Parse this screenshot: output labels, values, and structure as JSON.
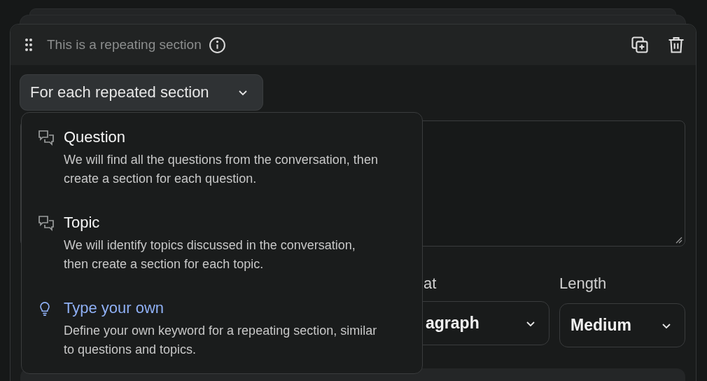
{
  "section": {
    "title": "This is a repeating section"
  },
  "repeat_select": {
    "value": "For each repeated section",
    "expanded": true
  },
  "menu": [
    {
      "kind": "preset",
      "title": "Question",
      "description": "We will find all the questions from the conversation, then create a section for each question."
    },
    {
      "kind": "preset",
      "title": "Topic",
      "description": "We will identify topics discussed in the conversation, then create a section for each topic."
    },
    {
      "kind": "custom",
      "title": "Type your own",
      "description": "Define your own keyword for a repeating section, similar to questions and topics."
    }
  ],
  "format": {
    "label": "at",
    "value": "agraph"
  },
  "length": {
    "label": "Length",
    "value": "Medium"
  }
}
